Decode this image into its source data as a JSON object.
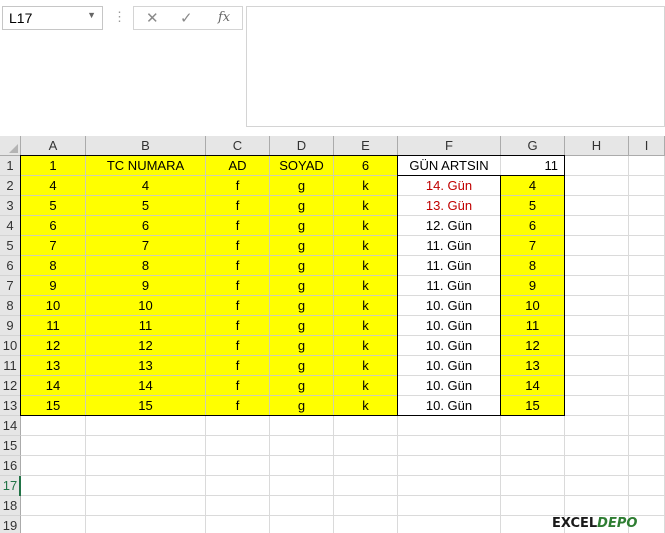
{
  "name_box": "L17",
  "formula_bar": {
    "cancel_icon": "x-icon",
    "confirm_icon": "check-icon",
    "fx_label": "fx",
    "content": ""
  },
  "columns": [
    "A",
    "B",
    "C",
    "D",
    "E",
    "F",
    "G",
    "H",
    "I"
  ],
  "rows": [
    "1",
    "2",
    "3",
    "4",
    "5",
    "6",
    "7",
    "8",
    "9",
    "10",
    "11",
    "12",
    "13",
    "14",
    "15",
    "16",
    "17",
    "18",
    "19"
  ],
  "active_row": "17",
  "header_row": [
    "1",
    "TC NUMARA",
    "AD",
    "SOYAD",
    "6",
    "GÜN ARTSIN",
    "11"
  ],
  "data_rows": [
    [
      "4",
      "4",
      "f",
      "g",
      "k",
      "14. Gün",
      "4"
    ],
    [
      "5",
      "5",
      "f",
      "g",
      "k",
      "13. Gün",
      "5"
    ],
    [
      "6",
      "6",
      "f",
      "g",
      "k",
      "12. Gün",
      "6"
    ],
    [
      "7",
      "7",
      "f",
      "g",
      "k",
      "11. Gün",
      "7"
    ],
    [
      "8",
      "8",
      "f",
      "g",
      "k",
      "11. Gün",
      "8"
    ],
    [
      "9",
      "9",
      "f",
      "g",
      "k",
      "11. Gün",
      "9"
    ],
    [
      "10",
      "10",
      "f",
      "g",
      "k",
      "10. Gün",
      "10"
    ],
    [
      "11",
      "11",
      "f",
      "g",
      "k",
      "10. Gün",
      "11"
    ],
    [
      "12",
      "12",
      "f",
      "g",
      "k",
      "10. Gün",
      "12"
    ],
    [
      "13",
      "13",
      "f",
      "g",
      "k",
      "10. Gün",
      "13"
    ],
    [
      "14",
      "14",
      "f",
      "g",
      "k",
      "10. Gün",
      "14"
    ],
    [
      "15",
      "15",
      "f",
      "g",
      "k",
      "10. Gün",
      "15"
    ]
  ],
  "red_f_rows": [
    0,
    1
  ],
  "colors": {
    "highlight": "#ffff00",
    "red_text": "#c00000",
    "header_bg": "#e6e6e6",
    "active": "#217346"
  },
  "watermark": {
    "part1": "EXCEL",
    "part2": "DEPO"
  }
}
